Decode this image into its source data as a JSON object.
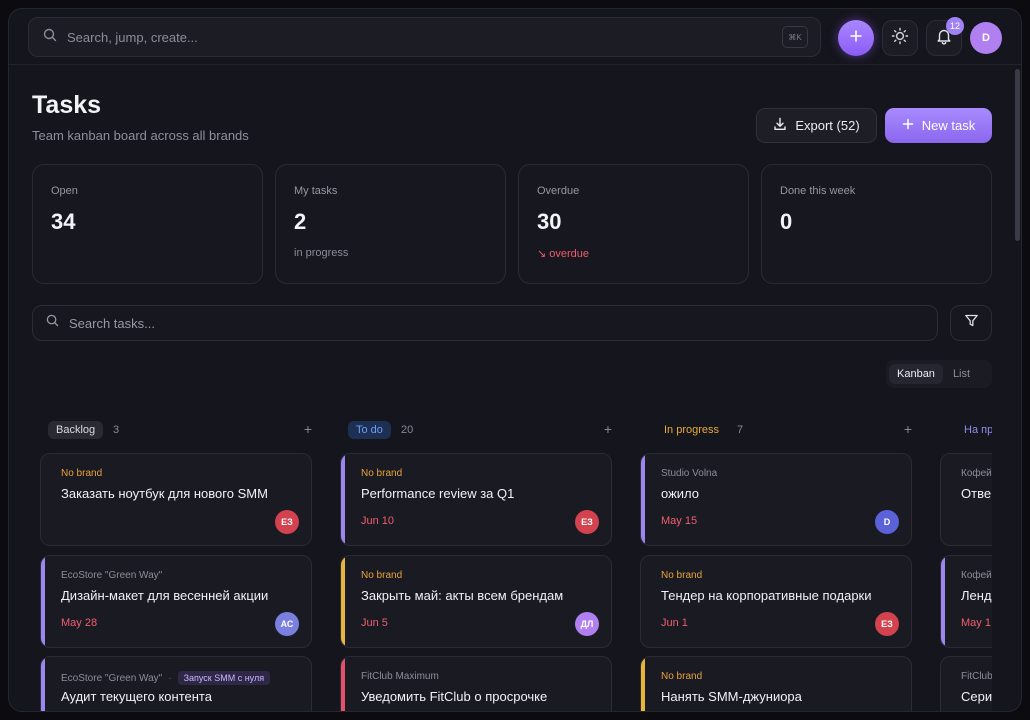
{
  "topbar": {
    "search_placeholder": "Search, jump, create...",
    "shortcut": "⌘K",
    "notifications_count": "12",
    "user_initial": "D"
  },
  "header": {
    "title": "Tasks",
    "subtitle": "Team kanban board across all brands",
    "export_label": "Export (52)",
    "new_task_label": "New task"
  },
  "stats": [
    {
      "label": "Open",
      "value": "34",
      "hint": ""
    },
    {
      "label": "My tasks",
      "value": "2",
      "hint": "in progress"
    },
    {
      "label": "Overdue",
      "value": "30",
      "hint": "↘ overdue"
    },
    {
      "label": "Done this week",
      "value": "0",
      "hint": ""
    }
  ],
  "task_search_placeholder": "Search tasks...",
  "views": [
    "Kanban",
    "List"
  ],
  "columns": [
    {
      "name": "Backlog",
      "count": "3",
      "add": "+",
      "chip_bg": "#2a2a33",
      "chip_fg": "#d9d9e2",
      "cards": [
        {
          "brand": "No brand",
          "tag": "",
          "title": "Заказать ноутбук для нового SMM",
          "due": "",
          "avatar": "ЕЗ",
          "avatar_color": "#d2424f",
          "strip": ""
        },
        {
          "brand": "EcoStore \"Green Way\"",
          "tag": "",
          "title": "Дизайн-макет для весенней акции",
          "due": "May 28",
          "avatar": "АС",
          "avatar_color": "#7a7fe0",
          "strip": "#9d86f0"
        },
        {
          "brand": "EcoStore \"Green Way\"",
          "tag": "Запуск SMM с нуля",
          "title": "Аудит текущего контента",
          "due": "",
          "avatar": "",
          "avatar_color": "",
          "strip": "#9d86f0"
        }
      ]
    },
    {
      "name": "To do",
      "count": "20",
      "add": "+",
      "chip_bg": "#1d2f52",
      "chip_fg": "#6f9ff5",
      "cards": [
        {
          "brand": "No brand",
          "tag": "",
          "title": "Performance review за Q1",
          "due": "Jun 10",
          "avatar": "ЕЗ",
          "avatar_color": "#d2424f",
          "strip": "#9d86f0"
        },
        {
          "brand": "No brand",
          "tag": "",
          "title": "Закрыть май: акты всем брендам",
          "due": "Jun 5",
          "avatar": "ДЛ",
          "avatar_color": "#b07ff0",
          "strip": "#e9b43b"
        },
        {
          "brand": "FitClub Maximum",
          "tag": "",
          "title": "Уведомить FitClub о просрочке",
          "due": "",
          "avatar": "",
          "avatar_color": "",
          "strip": "#e2506a"
        }
      ]
    },
    {
      "name": "In progress",
      "count": "7",
      "add": "+",
      "chip_bg": "transparent",
      "chip_fg": "#e9a93b",
      "cards": [
        {
          "brand": "Studio Volna",
          "tag": "",
          "title": "ожило",
          "due": "May 15",
          "avatar": "D",
          "avatar_color": "#5b62d8",
          "strip": "#9d86f0"
        },
        {
          "brand": "No brand",
          "tag": "",
          "title": "Тендер на корпоративные подарки",
          "due": "Jun 1",
          "avatar": "ЕЗ",
          "avatar_color": "#d2424f",
          "strip": ""
        },
        {
          "brand": "No brand",
          "tag": "",
          "title": "Нанять SMM-джуниора",
          "due": "",
          "avatar": "",
          "avatar_color": "",
          "strip": "#e9b43b"
        }
      ]
    },
    {
      "name": "На про",
      "count": "",
      "add": "",
      "chip_bg": "transparent",
      "chip_fg": "#8f8bf0",
      "cards": [
        {
          "brand": "Кофей",
          "tag": "",
          "title": "Отве",
          "due": "",
          "avatar": "",
          "avatar_color": "",
          "strip": ""
        },
        {
          "brand": "Кофей",
          "tag": "",
          "title": "Ленд",
          "due": "May 1",
          "avatar": "",
          "avatar_color": "",
          "strip": "#9d86f0"
        },
        {
          "brand": "FitClub",
          "tag": "",
          "title": "Сери",
          "due": "",
          "avatar": "",
          "avatar_color": "",
          "strip": ""
        }
      ]
    }
  ]
}
